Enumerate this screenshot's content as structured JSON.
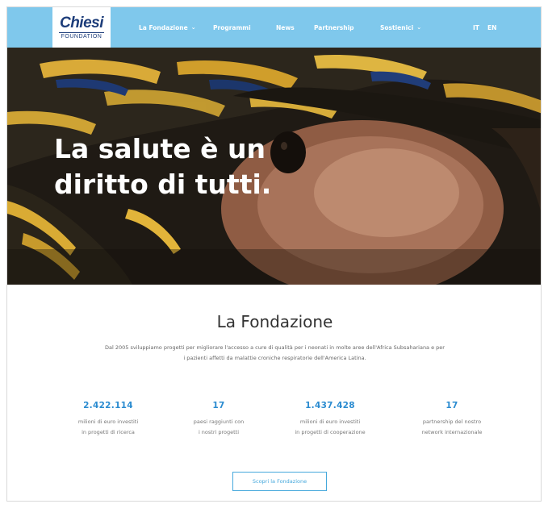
{
  "brand": {
    "logo_main": "Chiesi",
    "logo_sub": "FOUNDATION",
    "primary_color": "#7fc8ec",
    "logo_color": "#1d3d7a",
    "accent_color": "#2a8bd0"
  },
  "nav": {
    "items": [
      {
        "label": "La Fondazione",
        "has_dropdown": true
      },
      {
        "label": "Programmi",
        "has_dropdown": false
      },
      {
        "label": "News",
        "has_dropdown": false
      },
      {
        "label": "Partnership",
        "has_dropdown": false
      },
      {
        "label": "Sostienici",
        "has_dropdown": true
      }
    ],
    "languages": [
      "IT",
      "EN"
    ]
  },
  "hero": {
    "title_line1": "La salute è un",
    "title_line2": "diritto di tutti."
  },
  "foundation": {
    "title": "La Fondazione",
    "intro": "Dal 2005 sviluppiamo progetti per migliorare l'accesso a cure di qualità per i neonati in molte aree dell'Africa Subsahariana e per i pazienti affetti da malattie croniche respiratorie dell'America Latina.",
    "stats": [
      {
        "value": "2.422.114",
        "label_line1": "milioni di euro investiti",
        "label_line2": "in progetti di ricerca"
      },
      {
        "value": "17",
        "label_line1": "paesi raggiunti con",
        "label_line2": "i nostri progetti"
      },
      {
        "value": "1.437.428",
        "label_line1": "milioni di euro investiti",
        "label_line2": "in progetti di cooperazione"
      },
      {
        "value": "17",
        "label_line1": "partnership del nostro",
        "label_line2": "network internazionale"
      }
    ],
    "cta_label": "Scopri la Fondazione"
  }
}
